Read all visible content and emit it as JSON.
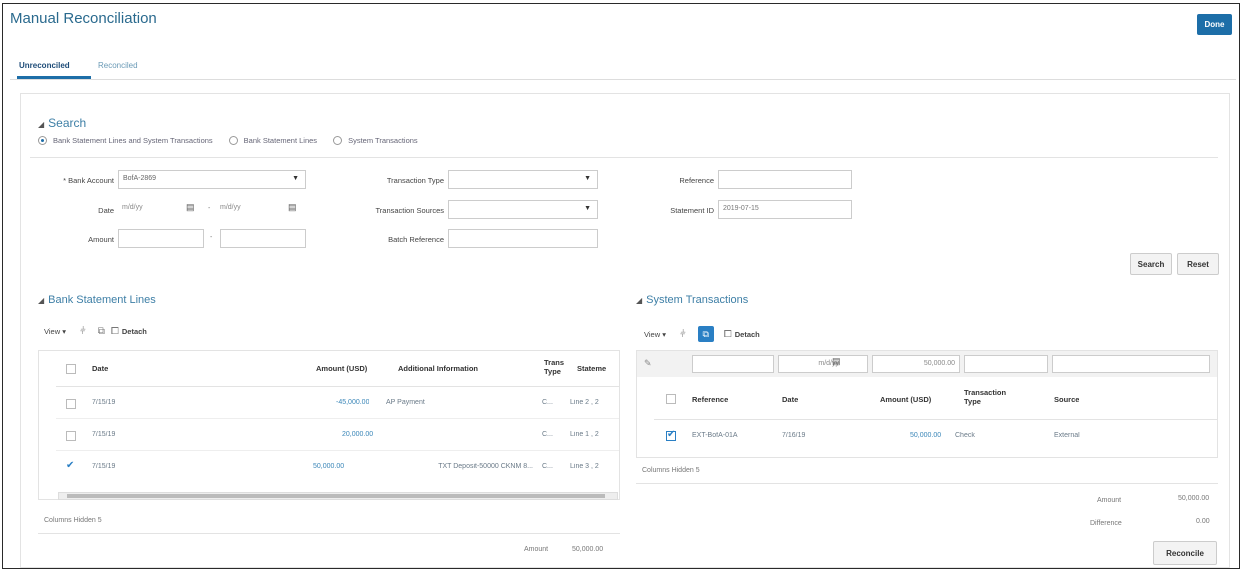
{
  "page": {
    "title": "Manual Reconciliation",
    "done_label": "Done"
  },
  "tabs": [
    {
      "label": "Unreconciled"
    },
    {
      "label": "Reconciled"
    }
  ],
  "search": {
    "title": "Search",
    "radios": [
      {
        "label": "Bank Statement Lines and System Transactions"
      },
      {
        "label": "Bank Statement Lines"
      },
      {
        "label": "System Transactions"
      }
    ],
    "bank_account_label": "* Bank Account",
    "bank_account_value": "BofA-2869",
    "date_label": "Date",
    "date_from_placeholder": "m/d/yy",
    "date_dash": "-",
    "date_to_placeholder": "m/d/yy",
    "amount_label": "Amount",
    "amount_dash": "-",
    "transaction_type_label": "Transaction Type",
    "transaction_sources_label": "Transaction Sources",
    "batch_reference_label": "Batch Reference",
    "reference_label": "Reference",
    "statement_id_label": "Statement ID",
    "statement_id_value": "2019-07-15",
    "search_button": "Search",
    "reset_button": "Reset"
  },
  "bank_lines": {
    "title": "Bank Statement Lines",
    "view_label": "View ▾",
    "detach_label": "Detach",
    "headers": {
      "date": "Date",
      "amount": "Amount (USD)",
      "additional_info": "Additional Information",
      "trans_type_line1": "Trans",
      "trans_type_line2": "Type",
      "statement": "Stateme"
    },
    "rows": [
      {
        "date": "7/15/19",
        "amount": "-45,000.00",
        "info": "AP Payment",
        "type": "C...",
        "statement": "Line 2 , 2",
        "checked": false
      },
      {
        "date": "7/15/19",
        "amount": "20,000.00",
        "info": "",
        "type": "C...",
        "statement": "Line 1 , 2",
        "checked": false
      },
      {
        "date": "7/15/19",
        "amount": "50,000.00",
        "info": "TXT Deposit-50000 CKNM 8...",
        "type": "C...",
        "statement": "Line 3 , 2",
        "checked": true
      }
    ],
    "columns_hidden": "Columns Hidden 5",
    "amount_label": "Amount",
    "amount_value": "50,000.00"
  },
  "system_tx": {
    "title": "System Transactions",
    "view_label": "View ▾",
    "detach_label": "Detach",
    "filter_date_placeholder": "m/d/yy",
    "filter_amount": "50,000.00",
    "headers": {
      "reference": "Reference",
      "date": "Date",
      "amount": "Amount (USD)",
      "trans_type_line1": "Transaction",
      "trans_type_line2": "Type",
      "source": "Source"
    },
    "rows": [
      {
        "reference": "EXT-BofA-01A",
        "date": "7/16/19",
        "amount": "50,000.00",
        "type": "Check",
        "source": "External",
        "checked": true
      }
    ],
    "columns_hidden": "Columns Hidden 5",
    "amount_label": "Amount",
    "amount_value": "50,000.00",
    "difference_label": "Difference",
    "difference_value": "0.00",
    "reconcile_button": "Reconcile"
  }
}
